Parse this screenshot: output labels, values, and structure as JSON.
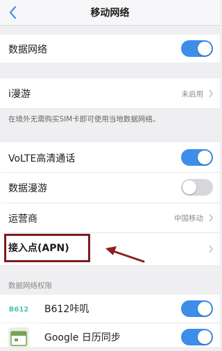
{
  "header": {
    "title": "移动网络"
  },
  "rows": {
    "mobile_data": {
      "label": "数据网络",
      "toggle": "on"
    },
    "i_roaming": {
      "label": "i漫游",
      "value": "未启用"
    },
    "i_roaming_note": "在境外无需购买SIM卡即可使用当地数据网络。",
    "volte": {
      "label": "VoLTE高清通话",
      "toggle": "on"
    },
    "data_roaming": {
      "label": "数据漫游",
      "toggle": "off"
    },
    "carrier": {
      "label": "运营商",
      "value": "中国移动"
    },
    "apn": {
      "label": "接入点(APN)"
    }
  },
  "permissions": {
    "header": "数据网络权限",
    "apps": [
      {
        "name": "B612咔叽",
        "icon": "b612-icon",
        "toggle": "on",
        "icon_text": "B612"
      },
      {
        "name": "Google 日历同步",
        "icon": "calendar-icon",
        "toggle": "on"
      }
    ]
  },
  "colors": {
    "accent": "#3d8ee8",
    "highlight": "#7a1b1b",
    "annotation_arrow": "#8b2020"
  }
}
